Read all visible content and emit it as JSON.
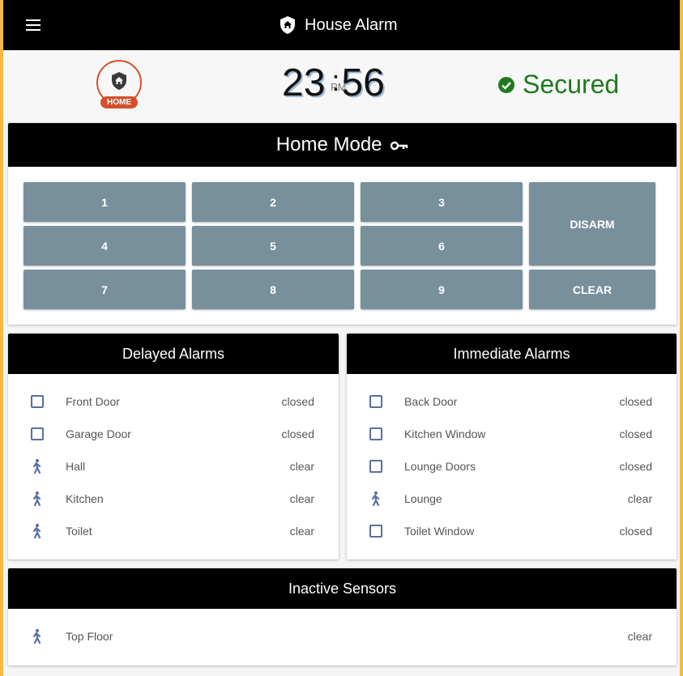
{
  "app": {
    "title": "House Alarm"
  },
  "status": {
    "mode_badge": "HOME",
    "clock": {
      "hours": "23",
      "minutes": "56",
      "ampm": "PM"
    },
    "state_text": "Secured"
  },
  "keypad": {
    "title": "Home Mode",
    "keys": [
      "1",
      "2",
      "3",
      "4",
      "5",
      "6",
      "7",
      "8",
      "9"
    ],
    "disarm_label": "DISARM",
    "clear_label": "CLEAR"
  },
  "delayed": {
    "title": "Delayed Alarms",
    "sensors": [
      {
        "name": "Front Door",
        "state": "closed",
        "icon": "door-sensor-checkbox-icon"
      },
      {
        "name": "Garage Door",
        "state": "closed",
        "icon": "door-sensor-checkbox-icon"
      },
      {
        "name": "Hall",
        "state": "clear",
        "icon": "motion-sensor-walk-icon"
      },
      {
        "name": "Kitchen",
        "state": "clear",
        "icon": "motion-sensor-walk-icon"
      },
      {
        "name": "Toilet",
        "state": "clear",
        "icon": "motion-sensor-walk-icon"
      }
    ]
  },
  "immediate": {
    "title": "Immediate Alarms",
    "sensors": [
      {
        "name": "Back Door",
        "state": "closed",
        "icon": "door-sensor-checkbox-icon"
      },
      {
        "name": "Kitchen Window",
        "state": "closed",
        "icon": "door-sensor-checkbox-icon"
      },
      {
        "name": "Lounge Doors",
        "state": "closed",
        "icon": "door-sensor-checkbox-icon"
      },
      {
        "name": "Lounge",
        "state": "clear",
        "icon": "motion-sensor-walk-icon"
      },
      {
        "name": "Toilet Window",
        "state": "closed",
        "icon": "door-sensor-checkbox-icon"
      }
    ]
  },
  "inactive": {
    "title": "Inactive Sensors",
    "sensors": [
      {
        "name": "Top Floor",
        "state": "clear",
        "icon": "motion-sensor-walk-icon"
      }
    ]
  },
  "colors": {
    "accent_orange": "#d4502a",
    "secured_green": "#1f7a1f",
    "keypad_button": "#78909c",
    "sensor_icon": "#5a6fa0",
    "page_border": "#f4b944"
  }
}
